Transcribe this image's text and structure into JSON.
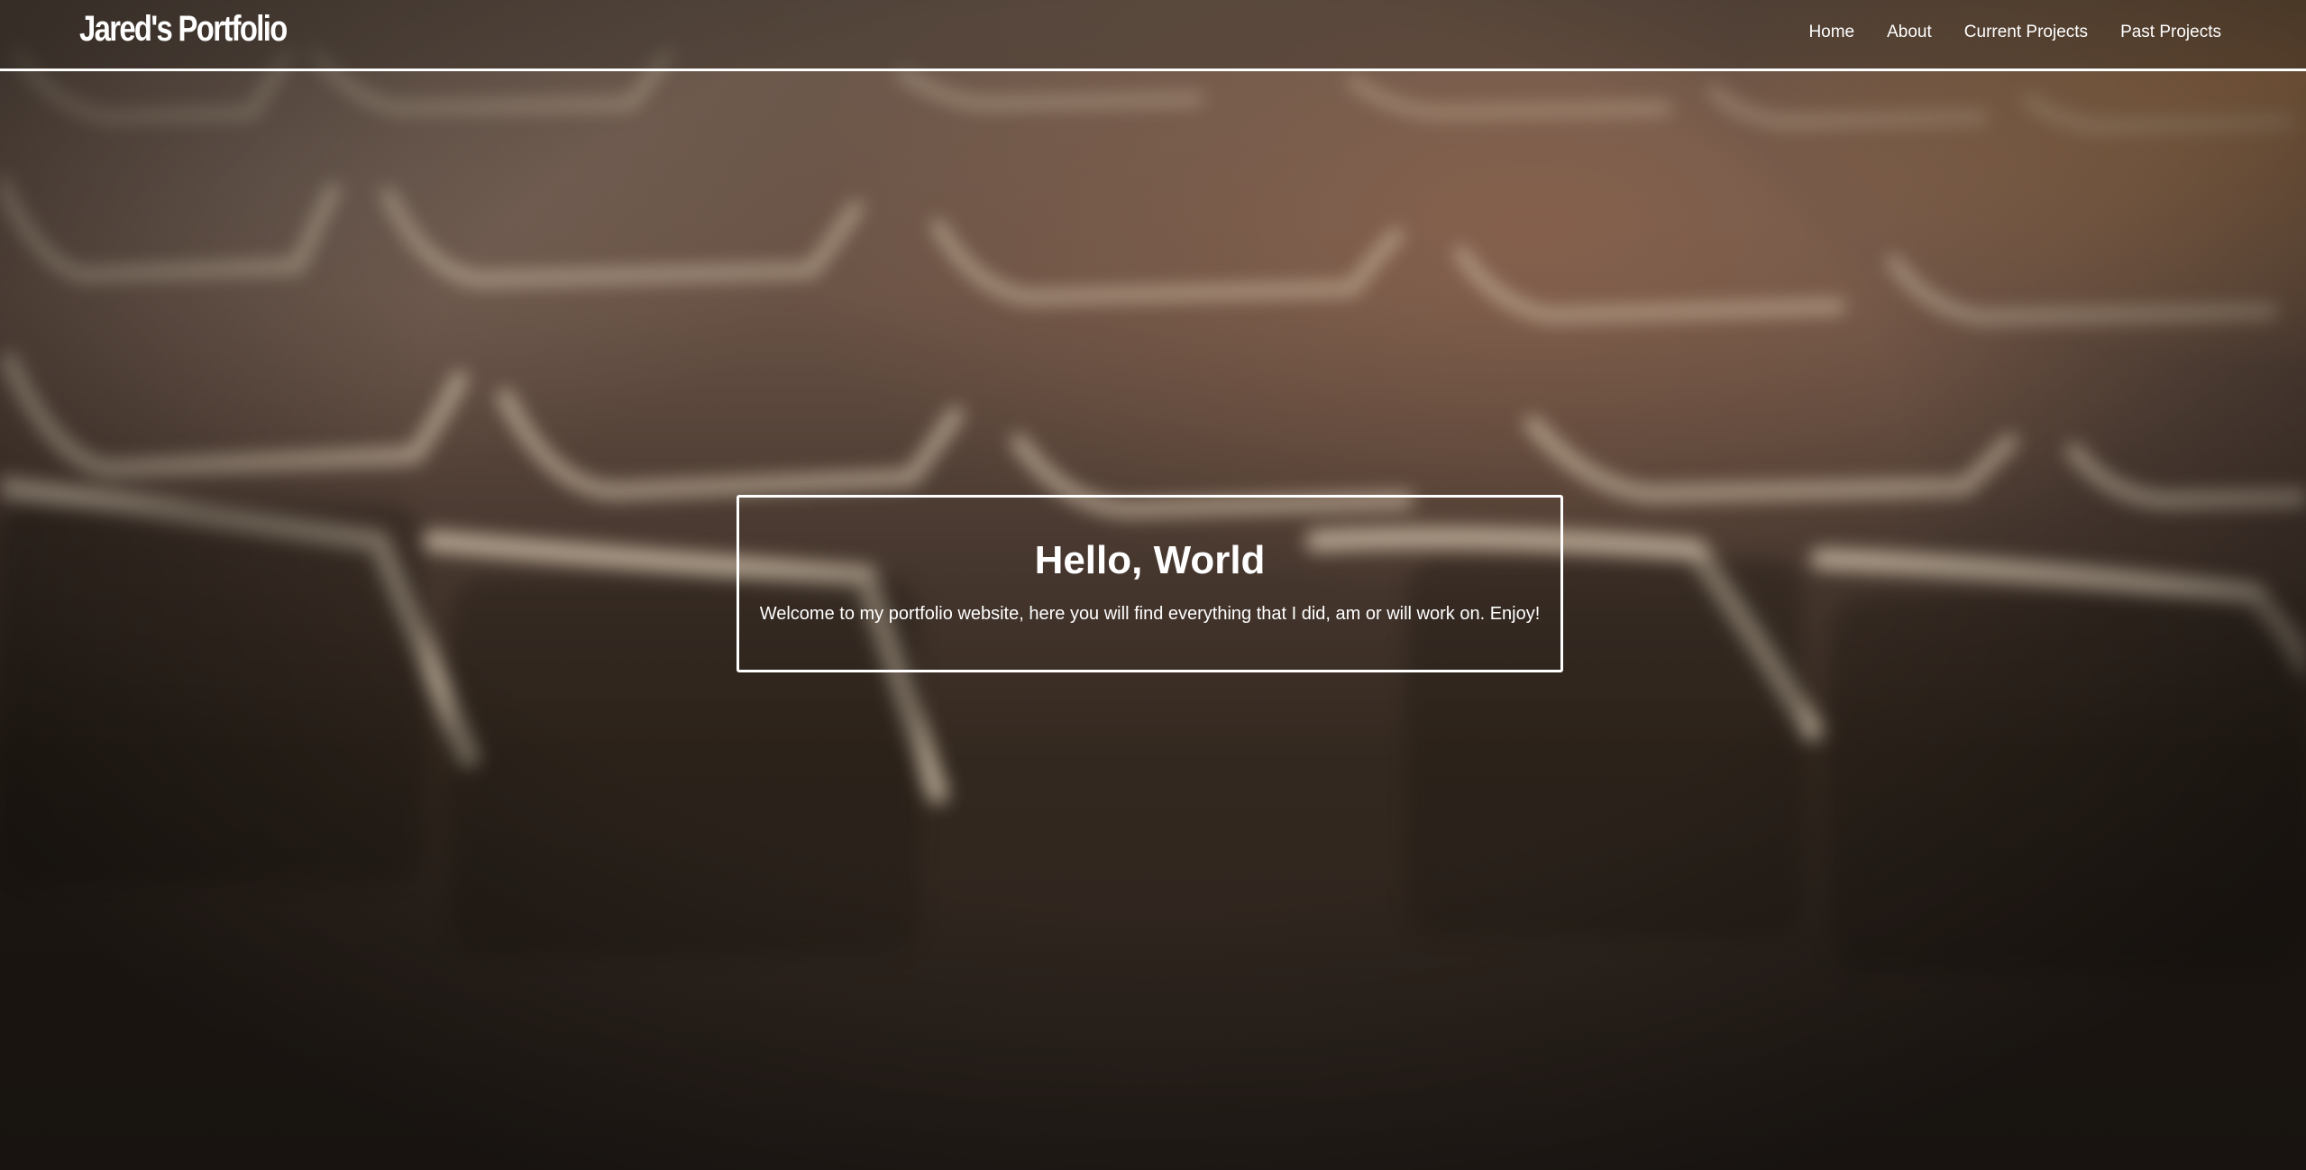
{
  "navbar": {
    "brand": "Jared's Portfolio",
    "links": [
      {
        "label": "Home"
      },
      {
        "label": "About"
      },
      {
        "label": "Current Projects"
      },
      {
        "label": "Past Projects"
      }
    ]
  },
  "hero": {
    "title": "Hello, World",
    "subtitle": "Welcome to my portfolio website, here you will find everything that I did, am or will work on. Enjoy!"
  },
  "colors": {
    "text": "#ffffff",
    "border": "#ffffff",
    "background_dark": "#2b231e",
    "background_warm": "#c48c5a"
  }
}
